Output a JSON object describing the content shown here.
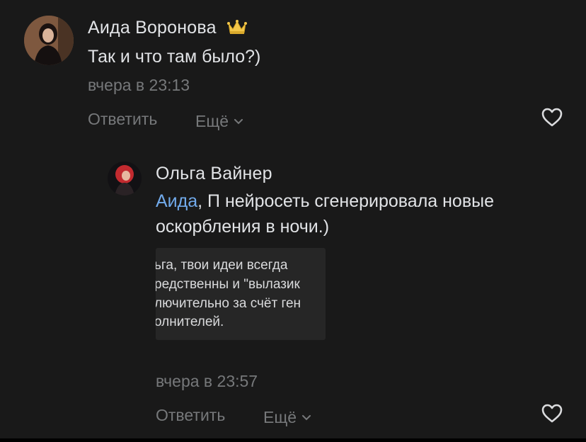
{
  "comment": {
    "author": "Аида Воронова",
    "text": "Так и что там было?)",
    "time": "вчера в 23:13",
    "reply_label": "Ответить",
    "more_label": "Ещё"
  },
  "reply": {
    "author": "Ольга Вайнер",
    "mention": "Аида",
    "text": ", П нейросеть сгенерировала новые",
    "text_line2": "оскорбления в ночи.)",
    "attachment_lines": [
      "ьга, твои идеи всегда",
      "редственны и \"вылазик",
      "лючительно за счёт ген",
      "олнителей."
    ],
    "time": "вчера в 23:57",
    "reply_label": "Ответить",
    "more_label": "Ещё"
  },
  "colors": {
    "background": "#191919",
    "text": "#e1e3e6",
    "secondary": "#76787a",
    "mention": "#71aaeb"
  }
}
